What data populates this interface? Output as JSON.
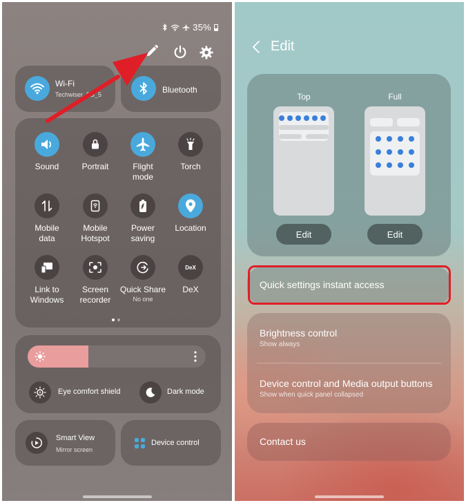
{
  "left_panel": {
    "status": {
      "text": "35%",
      "icons": [
        "bluetooth-icon",
        "wifi-icon",
        "airplane-icon",
        "battery-icon"
      ]
    },
    "top_actions": [
      "edit-pencil-icon",
      "power-icon",
      "settings-gear-icon"
    ],
    "wifi_tile": {
      "title": "Wi-Fi",
      "subtitle": "Techwiser_5G_5",
      "icon": "wifi-icon"
    },
    "bluetooth_tile": {
      "title": "Bluetooth",
      "icon": "bluetooth-icon"
    },
    "quick_tiles": [
      {
        "label": "Sound",
        "sub": "",
        "icon": "volume-icon",
        "active": true
      },
      {
        "label": "Portrait",
        "sub": "",
        "icon": "rotation-lock-icon",
        "active": false
      },
      {
        "label": "Flight\nmode",
        "sub": "",
        "icon": "airplane-icon",
        "active": true
      },
      {
        "label": "Torch",
        "sub": "",
        "icon": "torch-icon",
        "active": false
      },
      {
        "label": "Mobile\ndata",
        "sub": "",
        "icon": "mobile-data-icon",
        "active": false
      },
      {
        "label": "Mobile\nHotspot",
        "sub": "",
        "icon": "hotspot-icon",
        "active": false
      },
      {
        "label": "Power\nsaving",
        "sub": "",
        "icon": "power-saving-icon",
        "active": false
      },
      {
        "label": "Location",
        "sub": "",
        "icon": "location-pin-icon",
        "active": true
      },
      {
        "label": "Link to\nWindows",
        "sub": "",
        "icon": "link-to-windows-icon",
        "active": false
      },
      {
        "label": "Screen\nrecorder",
        "sub": "",
        "icon": "screen-recorder-icon",
        "active": false
      },
      {
        "label": "Quick Share",
        "sub": "No one",
        "icon": "quick-share-icon",
        "active": false
      },
      {
        "label": "DeX",
        "sub": "",
        "icon": "dex-icon",
        "active": false
      }
    ],
    "brightness": {
      "level": 0.34,
      "eye_comfort_label": "Eye comfort shield",
      "dark_mode_label": "Dark mode"
    },
    "smart_view": {
      "title": "Smart View",
      "subtitle": "Mirror screen"
    },
    "device_control": {
      "title": "Device control"
    },
    "colors": {
      "accent": "#4aa9dc",
      "brightness_fill": "#e99d9d",
      "arrow": "#e01e27"
    }
  },
  "right_panel": {
    "header": {
      "title": "Edit"
    },
    "layout_options": [
      {
        "label": "Top",
        "button": "Edit"
      },
      {
        "label": "Full",
        "button": "Edit"
      }
    ],
    "quick_settings_instant": {
      "title": "Quick settings instant access"
    },
    "brightness_control": {
      "title": "Brightness control",
      "subtitle": "Show always"
    },
    "device_media": {
      "title": "Device control and Media output buttons",
      "subtitle": "Show when quick panel collapsed"
    },
    "contact": {
      "title": "Contact us"
    },
    "colors": {
      "highlight": "#e01e27",
      "mock_dot": "#3a7fdb"
    }
  }
}
